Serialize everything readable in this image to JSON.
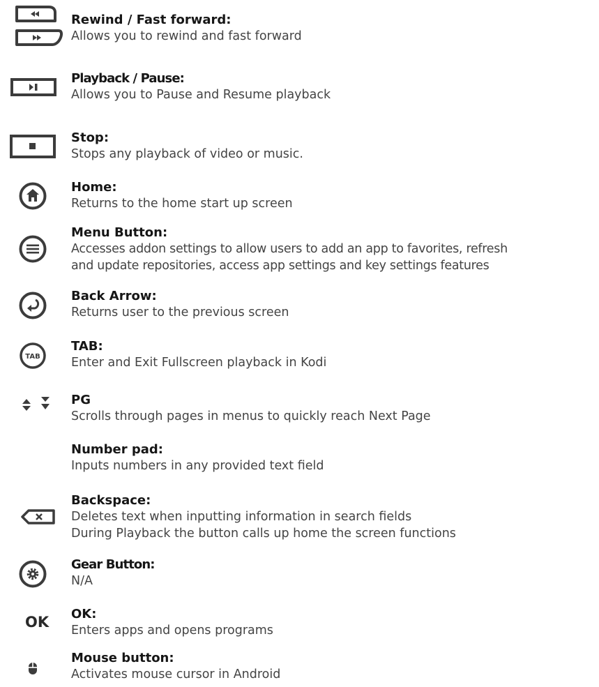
{
  "entries": [
    {
      "id": "rewind-fast-forward",
      "title": "Rewind / Fast forward:",
      "lines": [
        "Allows you to rewind and fast forward"
      ],
      "icon": "rewind-fast-forward-icon"
    },
    {
      "id": "playback-pause",
      "title": "Playback / Pause:",
      "lines": [
        "Allows you to Pause and Resume playback"
      ],
      "icon": "play-pause-icon"
    },
    {
      "id": "stop",
      "title": "Stop:",
      "lines": [
        "Stops any playback of video or music."
      ],
      "icon": "stop-icon"
    },
    {
      "id": "home",
      "title": "Home:",
      "lines": [
        "Returns to the home start up screen"
      ],
      "icon": "home-icon"
    },
    {
      "id": "menu-button",
      "title": "Menu Button:",
      "lines": [
        "Accesses addon settings to allow users to add an app to favorites, refresh",
        "and update repositories, access app settings and key settings features"
      ],
      "icon": "menu-icon"
    },
    {
      "id": "back-arrow",
      "title": "Back Arrow:",
      "lines": [
        "Returns user to the previous screen"
      ],
      "icon": "back-arrow-icon"
    },
    {
      "id": "tab",
      "title": "TAB:",
      "lines": [
        "Enter and Exit Fullscreen playback in Kodi"
      ],
      "icon": "tab-icon",
      "icon_text": "TAB"
    },
    {
      "id": "pg",
      "title": "PG",
      "lines": [
        "Scrolls through pages in menus to quickly reach Next Page"
      ],
      "icon": "page-up-down-icon"
    },
    {
      "id": "number-pad",
      "title": "Number pad:",
      "lines": [
        "Inputs numbers in any provided text field"
      ],
      "icon": ""
    },
    {
      "id": "backspace",
      "title": "Backspace:",
      "lines": [
        "Deletes text when inputting information in search fields",
        "During Playback the button calls up home the screen functions"
      ],
      "icon": "backspace-icon"
    },
    {
      "id": "gear-button",
      "title": "Gear Button:",
      "lines": [
        "N/A"
      ],
      "icon": "gear-icon"
    },
    {
      "id": "ok",
      "title": "OK:",
      "lines": [
        "Enters apps and opens programs"
      ],
      "icon": "ok-icon",
      "icon_text": "OK"
    },
    {
      "id": "mouse-button",
      "title": "Mouse button:",
      "lines": [
        "Activates mouse cursor in Android"
      ],
      "icon": "mouse-icon"
    }
  ],
  "colors": {
    "icon": "#3c3c3c",
    "title": "#161616",
    "text": "#444444",
    "background": "#ffffff"
  }
}
